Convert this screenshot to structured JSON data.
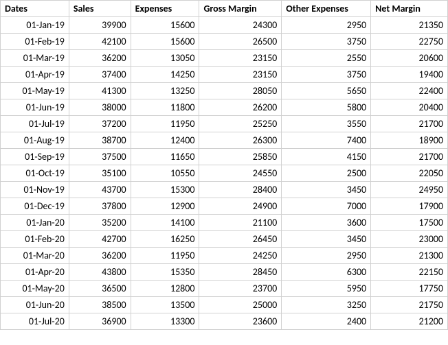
{
  "headers": {
    "dates": "Dates",
    "sales": "Sales",
    "expenses": "Expenses",
    "gross_margin": "Gross Margin",
    "other_expenses": "Other Expenses",
    "net_margin": "Net Margin"
  },
  "rows": [
    {
      "date": "01-Jan-19",
      "sales": "39900",
      "expenses": "15600",
      "gross_margin": "24300",
      "other_expenses": "2950",
      "net_margin": "21350"
    },
    {
      "date": "01-Feb-19",
      "sales": "42100",
      "expenses": "15600",
      "gross_margin": "26500",
      "other_expenses": "3750",
      "net_margin": "22750"
    },
    {
      "date": "01-Mar-19",
      "sales": "36200",
      "expenses": "13050",
      "gross_margin": "23150",
      "other_expenses": "2550",
      "net_margin": "20600"
    },
    {
      "date": "01-Apr-19",
      "sales": "37400",
      "expenses": "14250",
      "gross_margin": "23150",
      "other_expenses": "3750",
      "net_margin": "19400"
    },
    {
      "date": "01-May-19",
      "sales": "41300",
      "expenses": "13250",
      "gross_margin": "28050",
      "other_expenses": "5650",
      "net_margin": "22400"
    },
    {
      "date": "01-Jun-19",
      "sales": "38000",
      "expenses": "11800",
      "gross_margin": "26200",
      "other_expenses": "5800",
      "net_margin": "20400"
    },
    {
      "date": "01-Jul-19",
      "sales": "37200",
      "expenses": "11950",
      "gross_margin": "25250",
      "other_expenses": "3550",
      "net_margin": "21700"
    },
    {
      "date": "01-Aug-19",
      "sales": "38700",
      "expenses": "12400",
      "gross_margin": "26300",
      "other_expenses": "7400",
      "net_margin": "18900"
    },
    {
      "date": "01-Sep-19",
      "sales": "37500",
      "expenses": "11650",
      "gross_margin": "25850",
      "other_expenses": "4150",
      "net_margin": "21700"
    },
    {
      "date": "01-Oct-19",
      "sales": "35100",
      "expenses": "10550",
      "gross_margin": "24550",
      "other_expenses": "2500",
      "net_margin": "22050"
    },
    {
      "date": "01-Nov-19",
      "sales": "43700",
      "expenses": "15300",
      "gross_margin": "28400",
      "other_expenses": "3450",
      "net_margin": "24950"
    },
    {
      "date": "01-Dec-19",
      "sales": "37800",
      "expenses": "12900",
      "gross_margin": "24900",
      "other_expenses": "7000",
      "net_margin": "17900"
    },
    {
      "date": "01-Jan-20",
      "sales": "35200",
      "expenses": "14100",
      "gross_margin": "21100",
      "other_expenses": "3600",
      "net_margin": "17500"
    },
    {
      "date": "01-Feb-20",
      "sales": "42700",
      "expenses": "16250",
      "gross_margin": "26450",
      "other_expenses": "3450",
      "net_margin": "23000"
    },
    {
      "date": "01-Mar-20",
      "sales": "36200",
      "expenses": "11950",
      "gross_margin": "24250",
      "other_expenses": "2950",
      "net_margin": "21300"
    },
    {
      "date": "01-Apr-20",
      "sales": "43800",
      "expenses": "15350",
      "gross_margin": "28450",
      "other_expenses": "6300",
      "net_margin": "22150"
    },
    {
      "date": "01-May-20",
      "sales": "36500",
      "expenses": "12800",
      "gross_margin": "23700",
      "other_expenses": "5950",
      "net_margin": "17750"
    },
    {
      "date": "01-Jun-20",
      "sales": "38500",
      "expenses": "13500",
      "gross_margin": "25000",
      "other_expenses": "3250",
      "net_margin": "21750"
    },
    {
      "date": "01-Jul-20",
      "sales": "36900",
      "expenses": "13300",
      "gross_margin": "23600",
      "other_expenses": "2400",
      "net_margin": "21200"
    }
  ]
}
